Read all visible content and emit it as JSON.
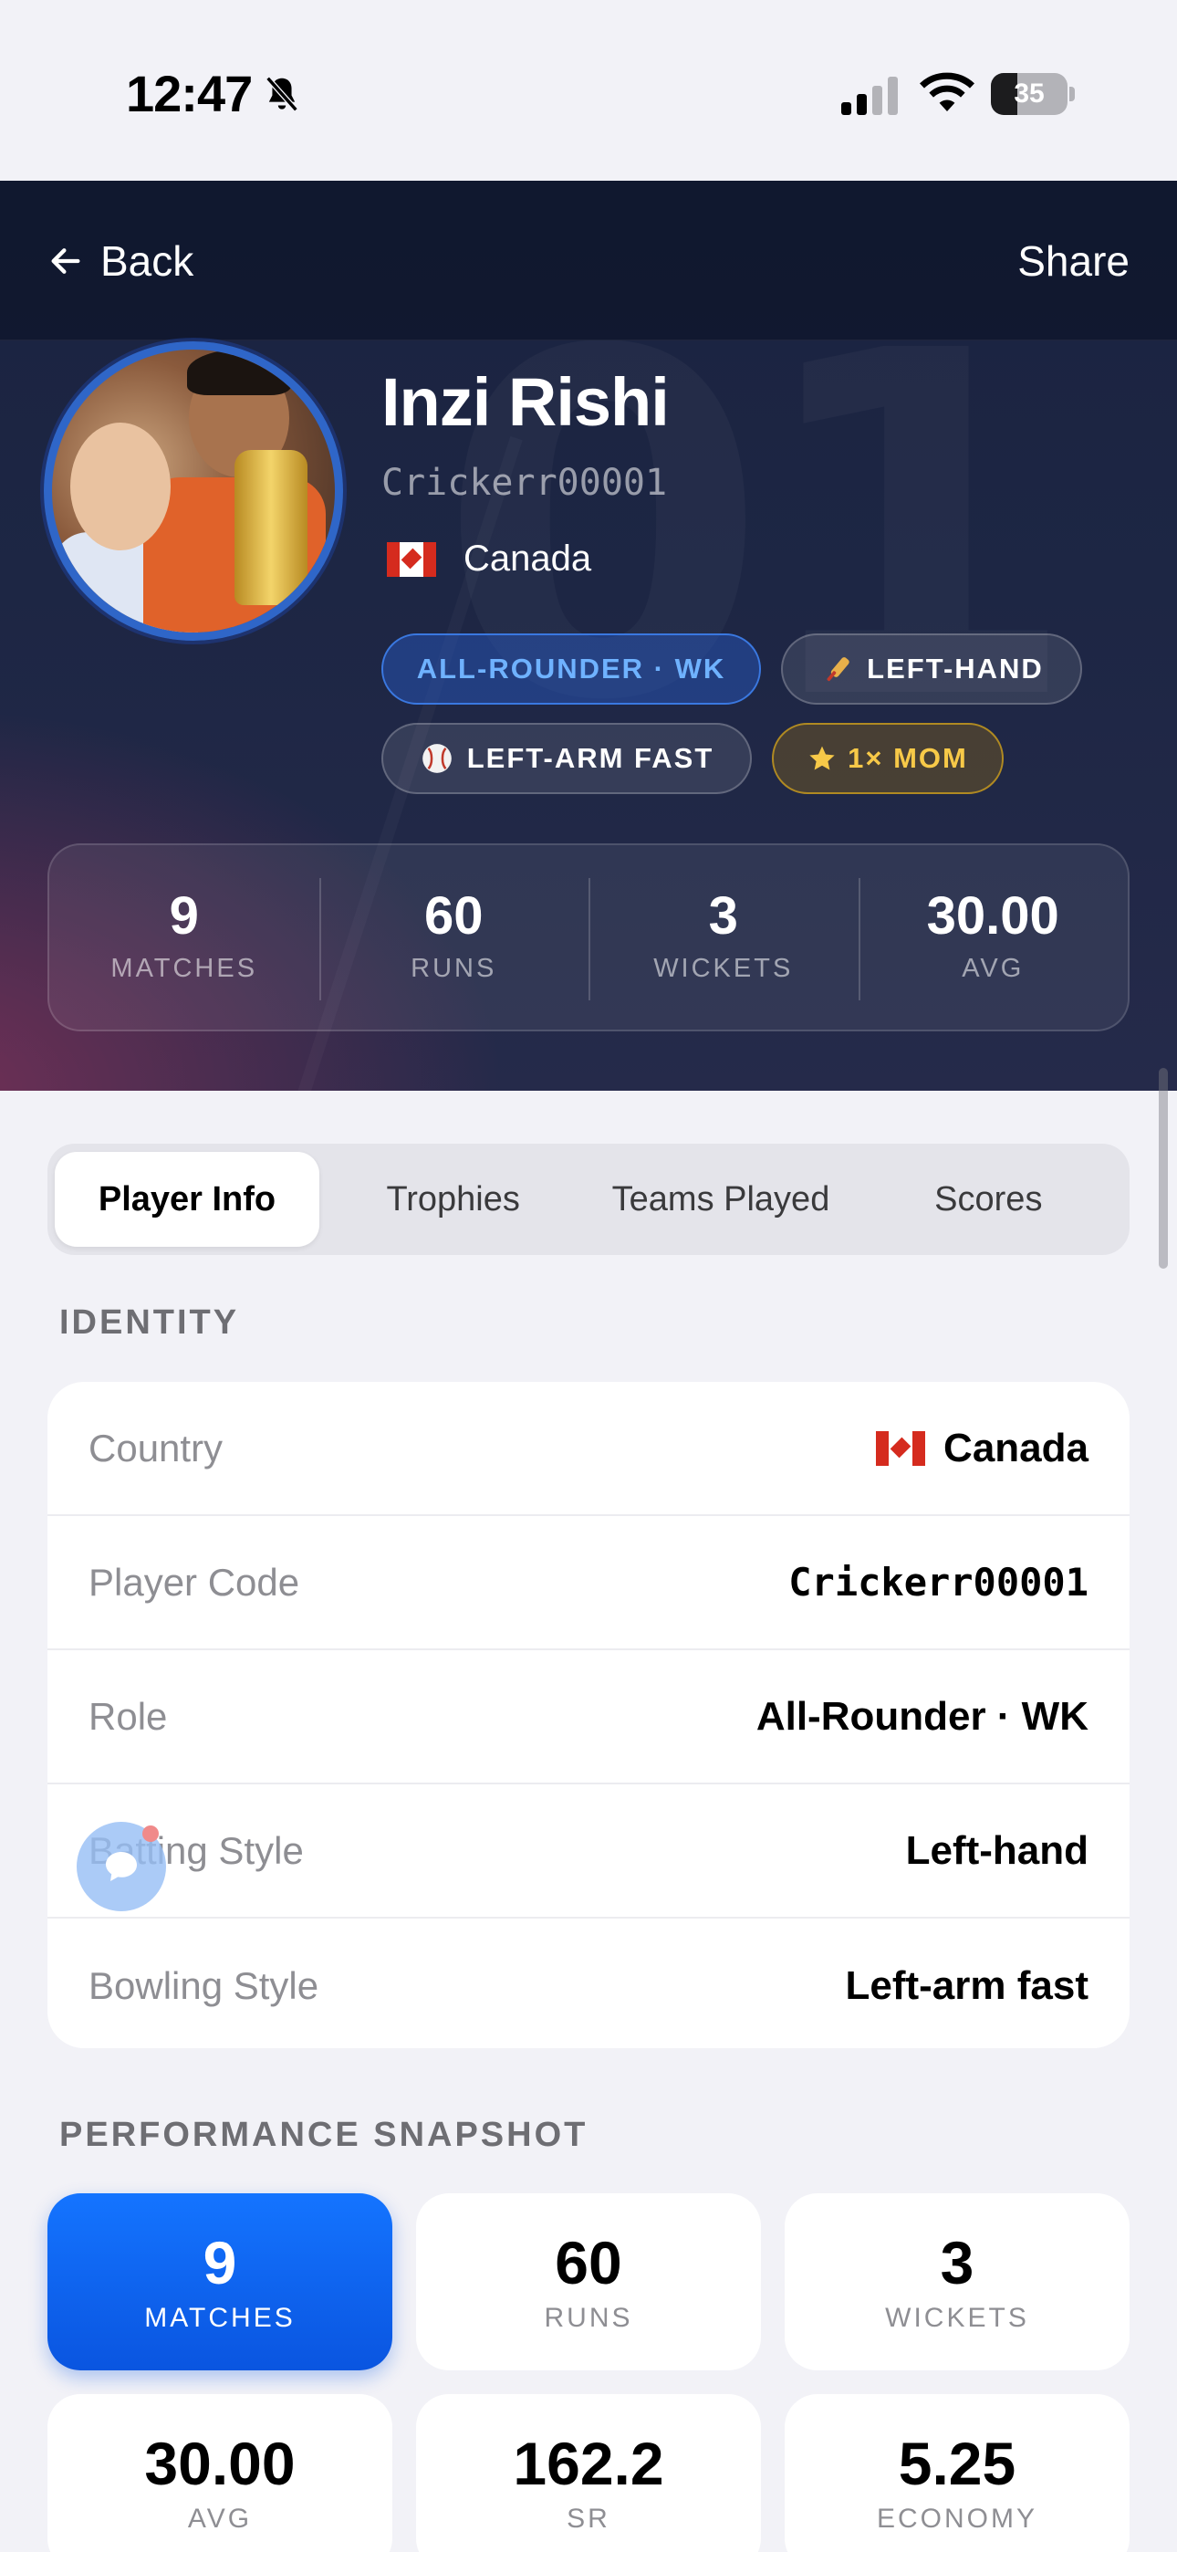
{
  "status_bar": {
    "time": "12:47",
    "battery": "35",
    "battery_level": 0.35
  },
  "nav": {
    "back_label": "Back",
    "share_label": "Share"
  },
  "profile": {
    "name": "Inzi Rishi",
    "code": "Crickerr00001",
    "country": "Canada",
    "chips": {
      "role": "ALL-ROUNDER · WK",
      "batting": "LEFT-HAND",
      "bowling": "LEFT-ARM FAST",
      "mom": "1× MOM"
    },
    "watermark": "01"
  },
  "hero_stats": [
    {
      "value": "9",
      "label": "MATCHES"
    },
    {
      "value": "60",
      "label": "RUNS"
    },
    {
      "value": "3",
      "label": "WICKETS"
    },
    {
      "value": "30.00",
      "label": "AVG"
    }
  ],
  "tabs": [
    "Player Info",
    "Trophies",
    "Teams Played",
    "Scores"
  ],
  "active_tab": "Player Info",
  "identity": {
    "title": "IDENTITY",
    "rows": [
      {
        "label": "Country",
        "value": "Canada"
      },
      {
        "label": "Player Code",
        "value": "Crickerr00001"
      },
      {
        "label": "Role",
        "value": "All-Rounder · WK"
      },
      {
        "label": "Batting Style",
        "value": "Left-hand"
      },
      {
        "label": "Bowling Style",
        "value": "Left-arm fast"
      }
    ]
  },
  "performance": {
    "title": "PERFORMANCE SNAPSHOT",
    "tiles": [
      {
        "value": "9",
        "label": "MATCHES"
      },
      {
        "value": "60",
        "label": "RUNS"
      },
      {
        "value": "3",
        "label": "WICKETS"
      },
      {
        "value": "30.00",
        "label": "AVG"
      },
      {
        "value": "162.2",
        "label": "SR"
      },
      {
        "value": "5.25",
        "label": "ECONOMY"
      }
    ]
  },
  "colors": {
    "accent": "#0a6cff",
    "hero_bg": "#1d2644",
    "role_chip": "#3a78e0",
    "mom_chip": "#f7c948",
    "page_bg": "#f2f2f7"
  },
  "icons": {
    "back": "arrow-left-icon",
    "bat": "cricket-bat-icon",
    "ball": "cricket-ball-icon",
    "star": "star-icon",
    "chat": "chat-icon",
    "flag": "canada-flag-icon"
  }
}
